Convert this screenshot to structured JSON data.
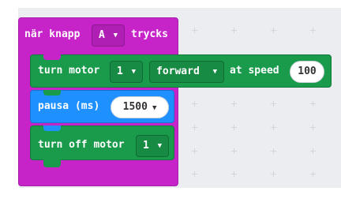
{
  "event_block": {
    "prefix": "när knapp",
    "button_value": "A",
    "suffix": "trycks"
  },
  "motor_block": {
    "label": "turn motor",
    "motor_value": "1",
    "direction_value": "forward",
    "speed_label": "at speed",
    "speed_value": "100"
  },
  "pause_block": {
    "label": "pausa (ms)",
    "duration_value": "1500"
  },
  "motor_off_block": {
    "label": "turn off motor",
    "motor_value": "1"
  },
  "icons": {
    "dropdown": "caret-down-icon"
  },
  "colors": {
    "event": "#c623c9",
    "motor": "#1a9b4c",
    "pause": "#1e90ff",
    "workspace": "#ecedf1"
  }
}
